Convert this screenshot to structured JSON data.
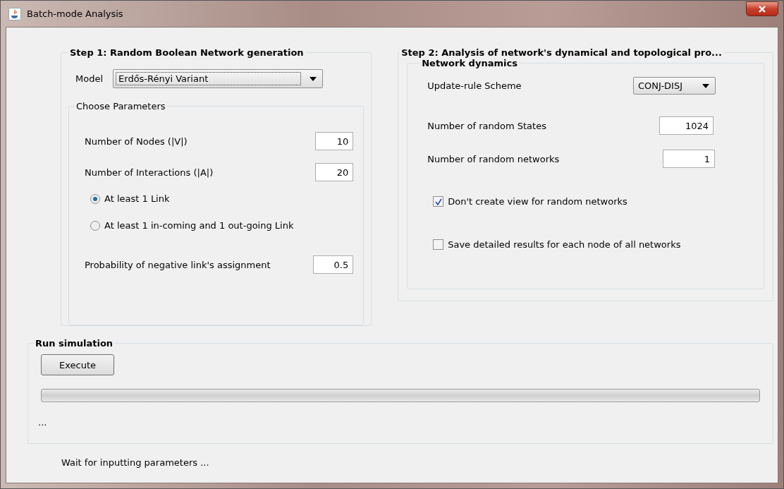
{
  "window": {
    "title": "Batch-mode Analysis"
  },
  "step1": {
    "title": "Step 1: Random Boolean Network generation",
    "model": {
      "label": "Model",
      "value": "Erdős-Rényi Variant"
    },
    "parameters": {
      "title": "Choose Parameters",
      "fields": [
        {
          "label": "Number of Nodes (|V|)",
          "value": "10"
        },
        {
          "label": "Number of Interactions (|A|)",
          "value": "20"
        }
      ],
      "link_options": [
        {
          "label": "At least 1 Link",
          "selected": true
        },
        {
          "label": "At least 1 in-coming  and 1 out-going Link",
          "selected": false
        }
      ],
      "probability": {
        "label": "Probability of negative link's assignment",
        "value": "0.5"
      }
    }
  },
  "step2": {
    "title": "Step 2: Analysis of network's dynamical and topological pro...",
    "dynamics": {
      "title": "Network dynamics",
      "scheme": {
        "label": "Update-rule Scheme",
        "value": "CONJ-DISJ"
      },
      "fields": [
        {
          "label": "Number of random States",
          "value": "1024"
        },
        {
          "label": "Number of random networks",
          "value": "1"
        }
      ],
      "options": [
        {
          "label": "Don't create view for random networks",
          "checked": true
        },
        {
          "label": "Save detailed results for each node of all networks",
          "checked": false
        }
      ]
    }
  },
  "run": {
    "title": "Run simulation",
    "button": "Execute",
    "progress": {
      "level": 0
    },
    "message": "..."
  },
  "status_bar": "Wait for inputting parameters ..."
}
